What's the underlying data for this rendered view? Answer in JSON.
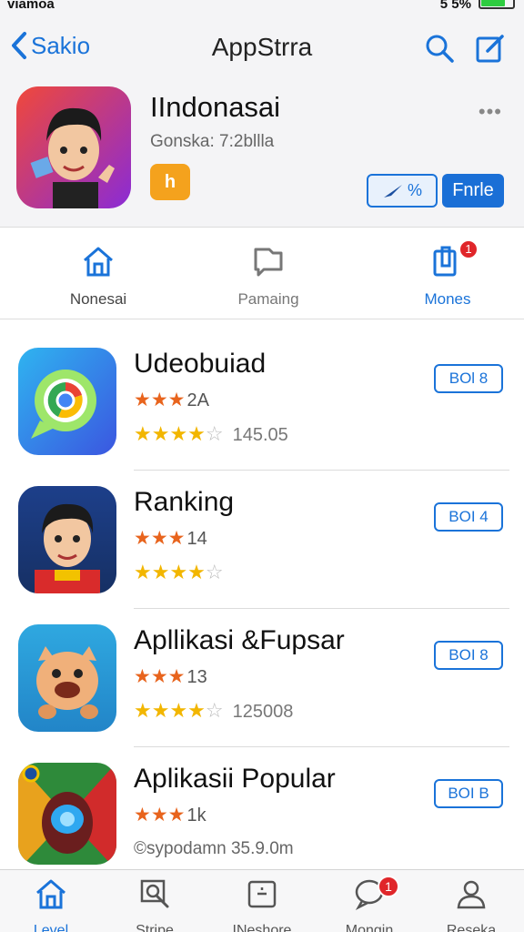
{
  "status_bar": {
    "carrier": "viamoa",
    "signal_battery": "5 5%"
  },
  "nav": {
    "back_label": "Sakio",
    "title": "AppStrra"
  },
  "hero": {
    "app_name": "IIndonasai",
    "subtitle": "Gonska: 7:2bllla",
    "badge": "h",
    "more": "•••",
    "share_label": "%",
    "free_label": "Fnrle"
  },
  "tabs": [
    {
      "label": "Nonesai",
      "active": false
    },
    {
      "label": "Pamaing",
      "active": false
    },
    {
      "label": "Mones",
      "active": true,
      "badge": "1"
    }
  ],
  "apps": [
    {
      "title": "Udeobuiad",
      "stars_small": "★★★",
      "count_small": "2A",
      "stars_full": 4,
      "stars_empty": 1,
      "rating_count": "145.05",
      "get_label": "BOl 8"
    },
    {
      "title": "Ranking",
      "stars_small": "★★★",
      "count_small": "14",
      "stars_full": 4,
      "stars_empty": 1,
      "rating_count": "",
      "get_label": "BOI 4"
    },
    {
      "title": "Apllikasi &Fupsar",
      "stars_small": "★★★",
      "count_small": "13",
      "stars_full": 4,
      "stars_empty": 1,
      "rating_count": "125008",
      "get_label": "BOI 8"
    },
    {
      "title": "Aplikasii Popular",
      "stars_small": "★★★",
      "count_small": "1k",
      "meta": "©sypodamn  35.9.0m",
      "get_label": "BOI B"
    }
  ],
  "tabbar": [
    {
      "label": "Level",
      "active": true
    },
    {
      "label": "Stripe",
      "active": false
    },
    {
      "label": "INeshore",
      "active": false
    },
    {
      "label": "Mongin",
      "active": false,
      "badge": "1"
    },
    {
      "label": "Reseka",
      "active": false
    }
  ],
  "colors": {
    "accent": "#1a73d9",
    "badge": "#e0262a",
    "star_small": "#e8641d",
    "star": "#f2b600"
  }
}
